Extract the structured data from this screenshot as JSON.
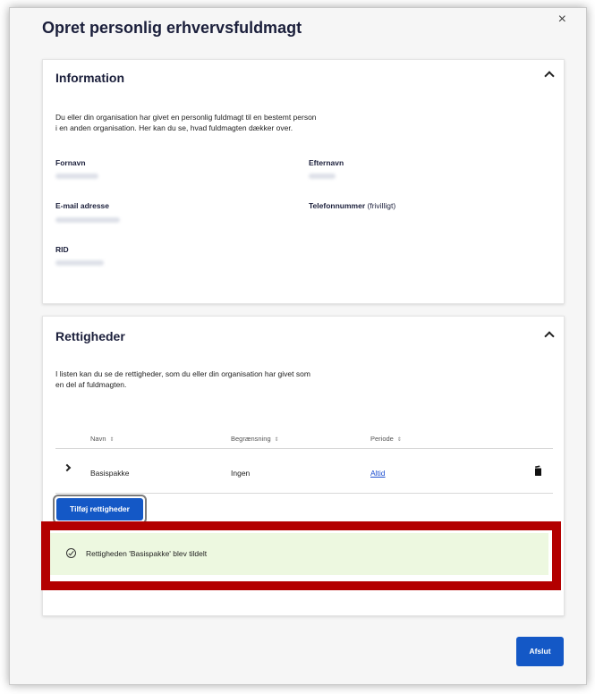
{
  "modal": {
    "title": "Opret personlig erhvervsfuldmagt",
    "close_label": "×"
  },
  "information": {
    "heading": "Information",
    "description_line1": "Du eller din organisation har givet en personlig fuldmagt til en bestemt person",
    "description_line2": "i en anden organisation. Her kan du se, hvad fuldmagten dækker over.",
    "fields": {
      "fornavn_label": "Fornavn",
      "efternavn_label": "Efternavn",
      "email_label": "E-mail adresse",
      "telefon_label": "Telefonnummer",
      "telefon_optional": "(frivilligt)",
      "rid_label": "RID"
    }
  },
  "rettigheder": {
    "heading": "Rettigheder",
    "description_line1": "I listen kan du se de rettigheder, som du eller din organisation har givet som",
    "description_line2": "en del af fuldmagten.",
    "columns": [
      "Navn",
      "Begrænsning",
      "Periode"
    ],
    "sort_glyph": "⇕",
    "rows": [
      {
        "navn": "Basispakke",
        "begraensning": "Ingen",
        "periode": "Altid"
      }
    ],
    "add_button": "Tilføj rettigheder"
  },
  "alert": {
    "message": "Rettigheden 'Basispakke' blev tildelt",
    "icon": "check-circle-icon"
  },
  "footer": {
    "finish_button": "Afslut"
  },
  "colors": {
    "primary": "#1458c6",
    "alert_bg": "#edf8e0",
    "alert_border": "#3e7d10",
    "highlight": "#b30000"
  }
}
